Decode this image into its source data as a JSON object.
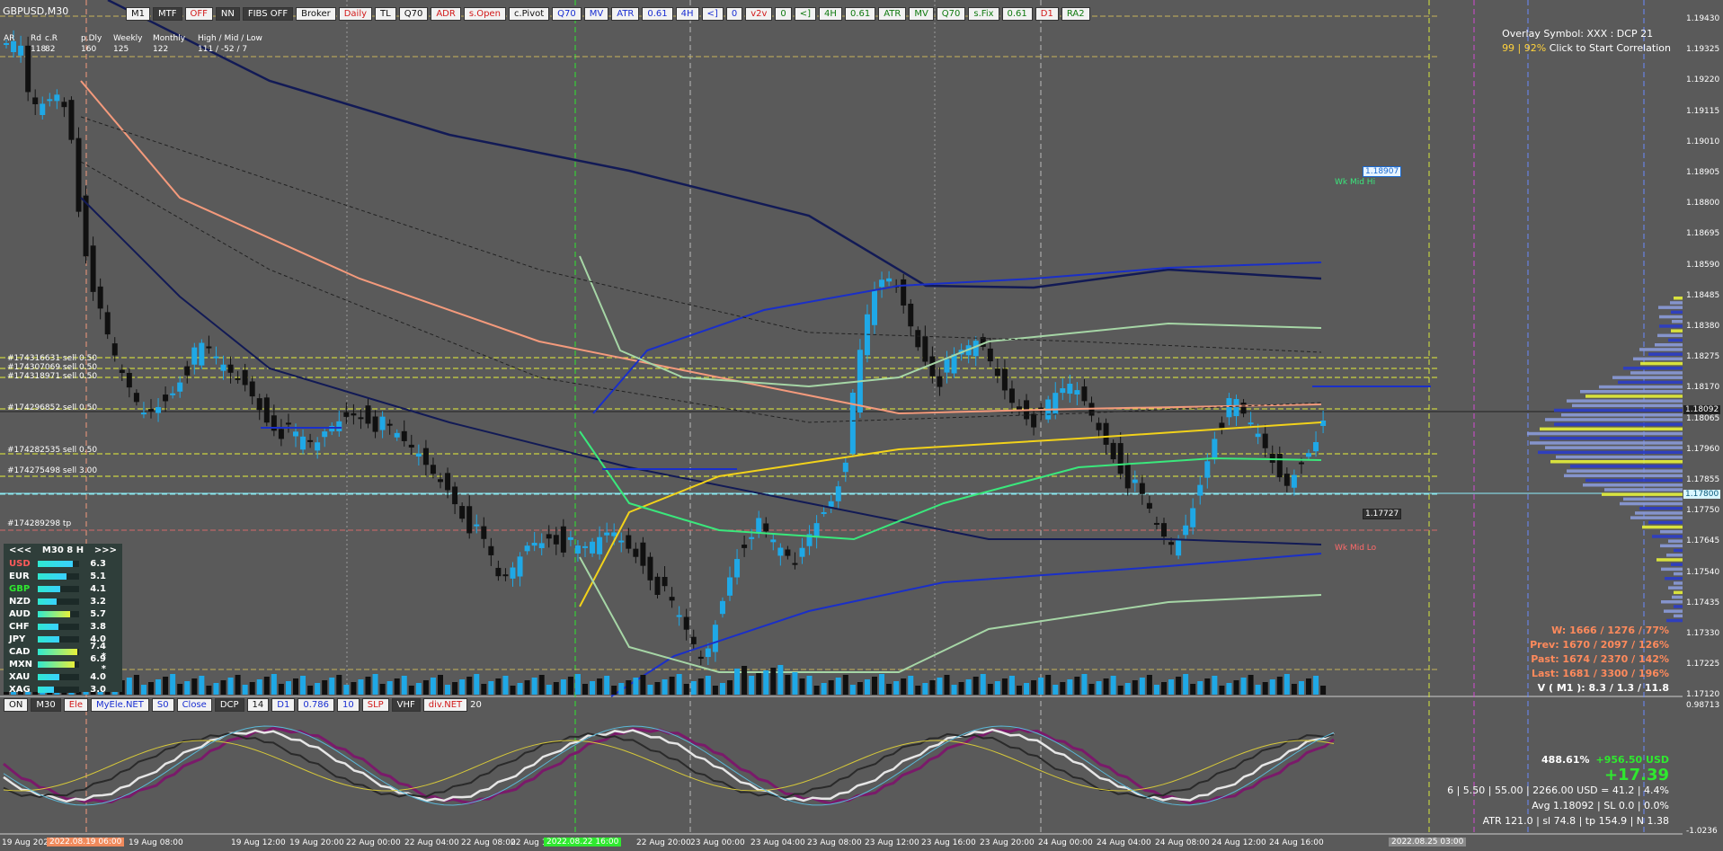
{
  "symbol": "GBPUSD,M30",
  "toolbar_top": [
    {
      "label": "M1",
      "style": "plain"
    },
    {
      "label": "MTF",
      "style": "dark"
    },
    {
      "label": "OFF",
      "style": "red"
    },
    {
      "label": "NN",
      "style": "dark"
    },
    {
      "label": "FIBS OFF",
      "style": "dark"
    },
    {
      "label": "Broker",
      "style": "plain"
    },
    {
      "label": "Daily",
      "style": "red"
    },
    {
      "label": "TL",
      "style": "plain"
    },
    {
      "label": "Q70",
      "style": "plain"
    },
    {
      "label": "ADR",
      "style": "red"
    },
    {
      "label": "s.Open",
      "style": "red"
    },
    {
      "label": "c.Pivot",
      "style": "plain"
    },
    {
      "label": "Q70",
      "style": "blue"
    },
    {
      "label": "MV",
      "style": "blue"
    },
    {
      "label": "ATR",
      "style": "blue"
    },
    {
      "label": "0.61",
      "style": "blue"
    },
    {
      "label": "4H",
      "style": "blue"
    },
    {
      "label": "<]",
      "style": "blue"
    },
    {
      "label": "0",
      "style": "blue"
    },
    {
      "label": "v2v",
      "style": "red"
    },
    {
      "label": "0",
      "style": "green"
    },
    {
      "label": "<]",
      "style": "green"
    },
    {
      "label": "4H",
      "style": "green"
    },
    {
      "label": "0.61",
      "style": "green"
    },
    {
      "label": "ATR",
      "style": "green"
    },
    {
      "label": "MV",
      "style": "green"
    },
    {
      "label": "Q70",
      "style": "green"
    },
    {
      "label": "s.Fix",
      "style": "green"
    },
    {
      "label": "0.61",
      "style": "green"
    },
    {
      "label": "D1",
      "style": "red"
    },
    {
      "label": "RA2",
      "style": "green"
    }
  ],
  "toolbar_bottom": [
    {
      "label": "ON",
      "style": "plain"
    },
    {
      "label": "M30",
      "style": "dark"
    },
    {
      "label": "Ele",
      "style": "red"
    },
    {
      "label": "MyEle.NET",
      "style": "blue"
    },
    {
      "label": "S0",
      "style": "blue"
    },
    {
      "label": "Close",
      "style": "blue"
    },
    {
      "label": "DCP",
      "style": "dark"
    },
    {
      "label": "14",
      "style": "plain"
    },
    {
      "label": "D1",
      "style": "blue"
    },
    {
      "label": "0.786",
      "style": "blue"
    },
    {
      "label": "10",
      "style": "blue"
    },
    {
      "label": "SLP",
      "style": "red"
    },
    {
      "label": "VHF",
      "style": "dark"
    },
    {
      "label": "div.NET",
      "style": "red"
    }
  ],
  "toolbar_bottom_extra": "20",
  "mini_table": {
    "headers": [
      "AR",
      "Rd",
      "c.R",
      "p.Dly",
      "Weekly",
      "Monthly",
      "High / Mid / Low"
    ],
    "values": [
      "118",
      "82",
      "160",
      "125",
      "122",
      "111 / -52 / 7"
    ]
  },
  "orders": [
    {
      "label": "#174316631 sell 0.50"
    },
    {
      "label": "#174307069 sell 0.50"
    },
    {
      "label": "#174318971 sell 0.50"
    },
    {
      "label": "#174296852 sell 0.50"
    },
    {
      "label": "#174282535 sell 0.50"
    },
    {
      "label": "#174275498 sell 3.00"
    },
    {
      "label": "#174289298 tp"
    }
  ],
  "d1_label": "D1",
  "overlay": {
    "line1": "Overlay Symbol: XXX : DCP 21",
    "line2_pct": "99 | 92%",
    "line2_text": "Click to Start Correlation"
  },
  "wk_labels": {
    "hi": "Wk Mid Hi",
    "lo": "Wk Mid Lo"
  },
  "box_tags": {
    "hi": "1.18907",
    "lo": "1.17727"
  },
  "currency_panel": {
    "prev": "<<<",
    "title": "M30  8  H",
    "next": ">>>",
    "rows": [
      {
        "name": "USD",
        "value": "6.3",
        "color": "#ff5a5a",
        "bar": "#3ad0ff",
        "bar_frac": 0.85
      },
      {
        "name": "EUR",
        "value": "5.1",
        "color": "#ffffff",
        "bar": "#3ad0ff",
        "bar_frac": 0.7
      },
      {
        "name": "GBP",
        "value": "4.1",
        "color": "#2fe82f",
        "bar": "#3ad0ff",
        "bar_frac": 0.55
      },
      {
        "name": "NZD",
        "value": "3.2",
        "color": "#ffffff",
        "bar": "#3ad0ff",
        "bar_frac": 0.45
      },
      {
        "name": "AUD",
        "value": "5.7",
        "color": "#ffffff",
        "bar": "#e8f03a",
        "bar_frac": 0.78
      },
      {
        "name": "CHF",
        "value": "3.8",
        "color": "#ffffff",
        "bar": "#3ad0ff",
        "bar_frac": 0.5
      },
      {
        "name": "JPY",
        "value": "4.0",
        "color": "#ffffff",
        "bar": "#3ad0ff",
        "bar_frac": 0.53
      },
      {
        "name": "CAD",
        "value": "7.4 *",
        "color": "#ffffff",
        "bar": "#e8f03a",
        "bar_frac": 0.95
      },
      {
        "name": "MXN",
        "value": "6.9 *",
        "color": "#ffffff",
        "bar": "#e8f03a",
        "bar_frac": 0.9
      },
      {
        "name": "XAU",
        "value": "4.0",
        "color": "#ffffff",
        "bar": "#3ad0ff",
        "bar_frac": 0.53
      },
      {
        "name": "XAG",
        "value": "3.0",
        "color": "#ffffff",
        "bar": "#3ad0ff",
        "bar_frac": 0.4
      }
    ]
  },
  "stats": {
    "w": "W: 1666 / 1276 / 77%",
    "prev": "Prev: 1670 / 2097 / 126%",
    "past": "Past: 1674 / 2370 / 142%",
    "last": "Last: 1681 / 3300 / 196%",
    "v": "V ( M1 ): 8.3 / 1.3 / 11.8"
  },
  "bottom_stats": {
    "pct": "488.61%",
    "profit_usd": "+956.50 USD",
    "profit_big": "+17.39",
    "line3": "6  |  5.50  |  55.00  |  2266.00 USD = 41.2  |  4.4%",
    "line4": "Avg 1.18092  |  SL 0.0  |  0.0%",
    "line5": "ATR 121.0  |  sl 74.8  |  tp 154.9  |  N 1.38"
  },
  "price_axis": {
    "ticks": [
      "1.19430",
      "1.19325",
      "1.19220",
      "1.19115",
      "1.19010",
      "1.18905",
      "1.18800",
      "1.18695",
      "1.18590",
      "1.18485",
      "1.18380",
      "1.18275",
      "1.18170",
      "1.18065",
      "1.17960",
      "1.17855",
      "1.17750",
      "1.17645",
      "1.17540",
      "1.17435",
      "1.17330",
      "1.17225",
      "1.17120"
    ],
    "current": "1.18092",
    "bid": "1.17800"
  },
  "osc_axis": {
    "top": "0.98713",
    "bottom": "-1.0236"
  },
  "time_axis": {
    "labels": [
      "19 Aug 2022",
      "19 Aug 08:00",
      "19 Aug 12:00",
      "19 Aug 20:00",
      "22 Aug 00:00",
      "22 Aug 04:00",
      "22 Aug 08:00",
      "22 Aug 12:00",
      "22 Aug 20:00",
      "23 Aug 00:00",
      "23 Aug 04:00",
      "23 Aug 08:00",
      "23 Aug 12:00",
      "23 Aug 16:00",
      "23 Aug 20:00",
      "24 Aug 00:00",
      "24 Aug 04:00",
      "24 Aug 08:00",
      "24 Aug 12:00",
      "24 Aug 16:00"
    ],
    "hl1": "2022.08.19 06:00",
    "hl2": "2022.08.22 16:00",
    "hl3": "2022.08.25 03:00"
  },
  "colors": {
    "bull": "#1fa8e6",
    "bear": "#101010",
    "ma_navy": "#121a55",
    "ma_salmon": "#f49a7c",
    "vwap_blue": "#1a2fc8",
    "yellow": "#f2d21a",
    "green": "#3ae87c",
    "pale_green": "#a6d6a6"
  }
}
